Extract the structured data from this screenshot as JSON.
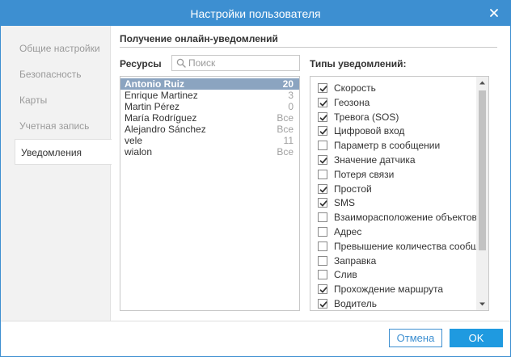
{
  "window": {
    "title": "Настройки пользователя"
  },
  "sidebar": {
    "items": [
      {
        "label": "Общие настройки",
        "active": false
      },
      {
        "label": "Безопасность",
        "active": false
      },
      {
        "label": "Карты",
        "active": false
      },
      {
        "label": "Учетная запись",
        "active": false
      },
      {
        "label": "Уведомления",
        "active": true
      }
    ]
  },
  "main": {
    "section_title": "Получение онлайн-уведомлений",
    "resources_label": "Ресурсы",
    "search_placeholder": "Поиск",
    "search_value": "",
    "types_label": "Типы уведомлений:",
    "resources": [
      {
        "name": "Antonio Ruiz",
        "count": "20",
        "selected": true
      },
      {
        "name": "Enrique Martinez",
        "count": "3",
        "selected": false
      },
      {
        "name": "Martin Pérez",
        "count": "0",
        "selected": false
      },
      {
        "name": "María Rodríguez",
        "count": "Все",
        "selected": false
      },
      {
        "name": "Alejandro Sánchez",
        "count": "Все",
        "selected": false
      },
      {
        "name": "vele",
        "count": "11",
        "selected": false
      },
      {
        "name": "wialon",
        "count": "Все",
        "selected": false
      }
    ],
    "notification_types": [
      {
        "label": "Скорость",
        "checked": true
      },
      {
        "label": "Геозона",
        "checked": true
      },
      {
        "label": "Тревога (SOS)",
        "checked": true
      },
      {
        "label": "Цифровой вход",
        "checked": true
      },
      {
        "label": "Параметр в сообщении",
        "checked": false
      },
      {
        "label": "Значение датчика",
        "checked": true
      },
      {
        "label": "Потеря связи",
        "checked": false
      },
      {
        "label": "Простой",
        "checked": true
      },
      {
        "label": "SMS",
        "checked": true
      },
      {
        "label": "Взаиморасположение объектов",
        "checked": false
      },
      {
        "label": "Адрес",
        "checked": false
      },
      {
        "label": "Превышение количества сообщений",
        "checked": false
      },
      {
        "label": "Заправка",
        "checked": false
      },
      {
        "label": "Слив",
        "checked": false
      },
      {
        "label": "Прохождение маршрута",
        "checked": true
      },
      {
        "label": "Водитель",
        "checked": true
      }
    ]
  },
  "footer": {
    "cancel_label": "Отмена",
    "ok_label": "OK"
  },
  "colors": {
    "accent": "#3d8fd1",
    "ok_button": "#1f9ae0",
    "selected_row": "#8ba4c0",
    "sidebar_bg": "#f2f2f2"
  },
  "icons": {
    "close": "close-icon",
    "search": "search-icon",
    "check": "check-icon",
    "scroll_up": "arrow-up-icon",
    "scroll_down": "arrow-down-icon"
  }
}
